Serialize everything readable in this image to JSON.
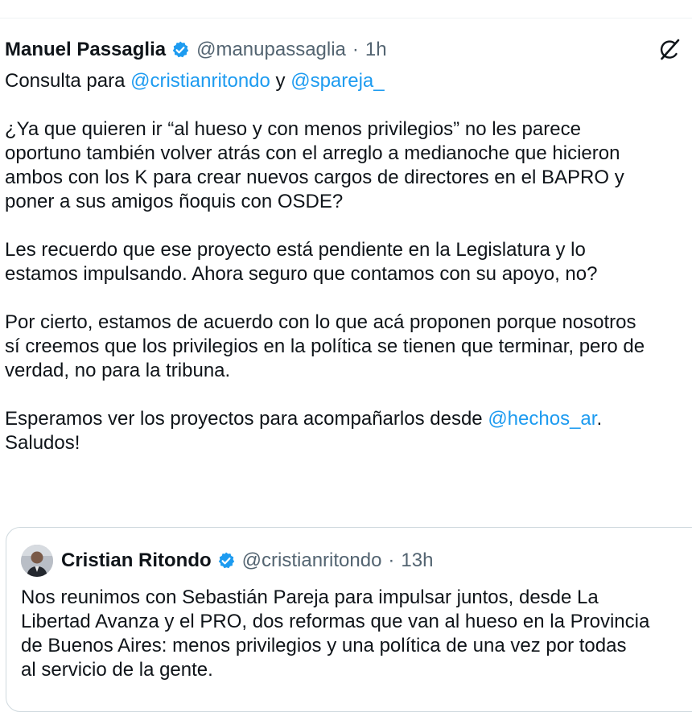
{
  "tweet": {
    "author_name": "Manuel Passaglia",
    "handle": "@manupassaglia",
    "separator": "·",
    "time": "1h",
    "line1_prefix": "Consulta para ",
    "mention1": "@cristianritondo",
    "line1_mid": " y ",
    "mention2": "@spareja_",
    "p2": [
      "¿Ya que quieren ir “al hueso y con menos privilegios” no les parece",
      "oportuno también volver atrás con el arreglo a medianoche que hicieron",
      "ambos con los K para crear nuevos cargos de directores en el BAPRO y",
      "poner a sus amigos ñoquis con OSDE?"
    ],
    "p3": [
      "Les recuerdo que ese proyecto está pendiente en la Legislatura y lo",
      "estamos impulsando. Ahora seguro que contamos con su apoyo, no?"
    ],
    "p4": [
      "Por cierto, estamos de acuerdo con lo que acá proponen porque nosotros",
      "sí creemos que los privilegios en la política se tienen que terminar, pero de",
      "verdad, no para la tribuna."
    ],
    "p5_prefix": "Esperamos ver los proyectos para acompañarlos desde ",
    "mention3": "@hechos_ar",
    "p5_suffix": ".",
    "closing": "Saludos!"
  },
  "quote": {
    "author_name": "Cristian Ritondo",
    "handle": "@cristianritondo",
    "separator": "·",
    "time": "13h",
    "lines": [
      "Nos reunimos con Sebastián Pareja para impulsar juntos, desde La",
      "Libertad Avanza y el PRO, dos reformas que van al hueso en la Provincia",
      "de Buenos Aires: menos privilegios y una política de una vez por todas",
      "al servicio de la gente."
    ]
  },
  "icons": {
    "verified": "verified-badge-icon",
    "grok": "grok-icon",
    "avatar": "profile-avatar"
  },
  "colors": {
    "text": "#0f1419",
    "secondary": "#536471",
    "link": "#1d9bf0",
    "border": "#cfd9de"
  }
}
